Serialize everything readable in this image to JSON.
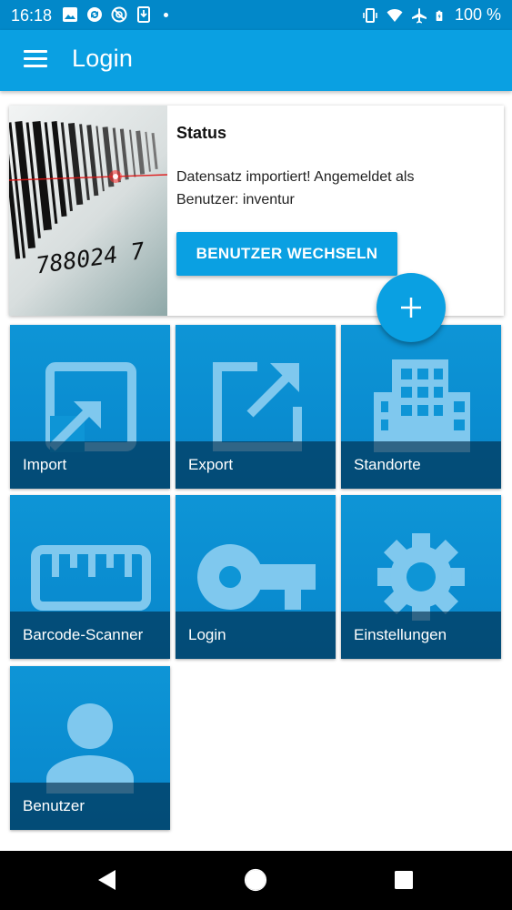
{
  "status_bar": {
    "time": "16:18",
    "battery": "100 %",
    "left_icons": [
      "image-icon",
      "sync-icon",
      "blocked-icon",
      "download-icon",
      "dot"
    ],
    "right_icons": [
      "vibrate-icon",
      "wifi-icon",
      "airplane-icon",
      "battery-icon"
    ]
  },
  "app_bar": {
    "title": "Login",
    "menu_icon": "menu-icon"
  },
  "status_card": {
    "title": "Status",
    "message": "Datensatz importiert! Angemeldet als Benutzer: inventur",
    "button_label": "BENUTZER WECHSELN",
    "barcode_digits": "788024 7"
  },
  "fab": {
    "icon": "plus-icon"
  },
  "tiles": [
    {
      "label": "Import",
      "icon": "import-icon"
    },
    {
      "label": "Export",
      "icon": "export-icon"
    },
    {
      "label": "Standorte",
      "icon": "building-icon"
    },
    {
      "label": "Barcode-Scanner",
      "icon": "ruler-icon"
    },
    {
      "label": "Login",
      "icon": "key-icon"
    },
    {
      "label": "Einstellungen",
      "icon": "gear-icon"
    },
    {
      "label": "Benutzer",
      "icon": "person-icon"
    }
  ],
  "nav_bar": {
    "buttons": [
      "back-icon",
      "home-icon",
      "recents-icon"
    ]
  },
  "colors": {
    "status_bar": "#0288c9",
    "app_bar": "#0aa0e2",
    "tile": "#0a8cd0",
    "tile_label_bg": "#00283f",
    "nav_bar": "#000000"
  }
}
